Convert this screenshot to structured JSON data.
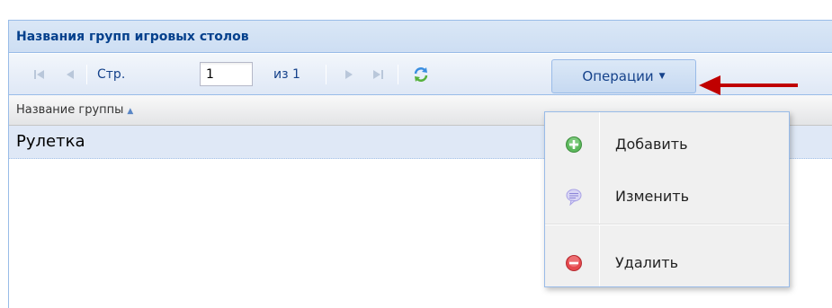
{
  "panel": {
    "title": "Названия групп игровых столов"
  },
  "toolbar": {
    "page_label": "Стр.",
    "page_value": "1",
    "of_label": "из 1",
    "operations_label": "Операции",
    "icons": [
      "first-page-icon",
      "prev-page-icon",
      "next-page-icon",
      "last-page-icon",
      "refresh-icon"
    ]
  },
  "grid": {
    "column_header": "Название группы",
    "rows": [
      "Рулетка"
    ]
  },
  "menu": {
    "items": [
      {
        "label": "Добавить",
        "icon": "add-icon"
      },
      {
        "label": "Изменить",
        "icon": "edit-icon"
      },
      {
        "label": "Удалить",
        "icon": "delete-icon"
      }
    ]
  },
  "colors": {
    "title": "#04408c",
    "toolbar_text": "#15428b",
    "row_selected": "#dfe8f6",
    "arrow": "#c00000",
    "add_green": "#5cb85c",
    "delete_red": "#e5484d"
  }
}
